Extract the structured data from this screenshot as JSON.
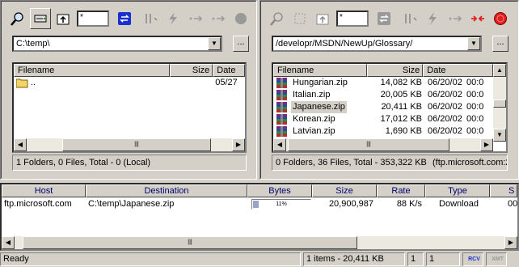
{
  "left_pane": {
    "mask": "*",
    "path": "C:\\temp\\",
    "browse_label": "...",
    "columns": [
      "Filename",
      "Size",
      "Date"
    ],
    "rows": [
      {
        "name": "..",
        "size": "",
        "date": "05/27"
      }
    ],
    "status": "1 Folders, 0 Files, Total - 0 (Local)"
  },
  "right_pane": {
    "mask": "*",
    "path": "/developr/MSDN/NewUp/Glossary/",
    "browse_label": "...",
    "columns": [
      "Filename",
      "Size",
      "Date"
    ],
    "rows": [
      {
        "name": "Hungarian.zip",
        "size": "14,082 KB",
        "date": "06/20/02",
        "time": "00:0"
      },
      {
        "name": "Italian.zip",
        "size": "20,005 KB",
        "date": "06/20/02",
        "time": "00:0"
      },
      {
        "name": "Japanese.zip",
        "size": "20,411 KB",
        "date": "06/20/02",
        "time": "00:0"
      },
      {
        "name": "Korean.zip",
        "size": "17,012 KB",
        "date": "06/20/02",
        "time": "00:0"
      },
      {
        "name": "Latvian.zip",
        "size": "1,690 KB",
        "date": "06/20/02",
        "time": "00:0"
      }
    ],
    "selected_row": 2,
    "status": "0 Folders, 36 Files, Total - 353,322 KB",
    "server": "(ftp.microsoft.com:2"
  },
  "queue": {
    "columns": [
      "Host",
      "Destination",
      "Bytes",
      "Size",
      "Rate",
      "Type",
      "S"
    ],
    "rows": [
      {
        "host": "ftp.microsoft.com",
        "destination": "C:\\temp\\Japanese.zip",
        "progress_percent": 11,
        "progress_label": "11%",
        "size": "20,900,987",
        "rate": "88 K/s",
        "type": "Download",
        "s": "00"
      }
    ]
  },
  "statusbar": {
    "ready": "Ready",
    "items": "1 items - 20,411 KB",
    "count1": "1",
    "count2": "1",
    "rcv": "RCV",
    "xmt": "XMT"
  },
  "colors": {
    "face": "#d4d0c8",
    "progress_fill": "#9aa3c8",
    "header_text": "#00006b",
    "stop_red": "#e02020",
    "link_blue": "#1a2fd0"
  }
}
